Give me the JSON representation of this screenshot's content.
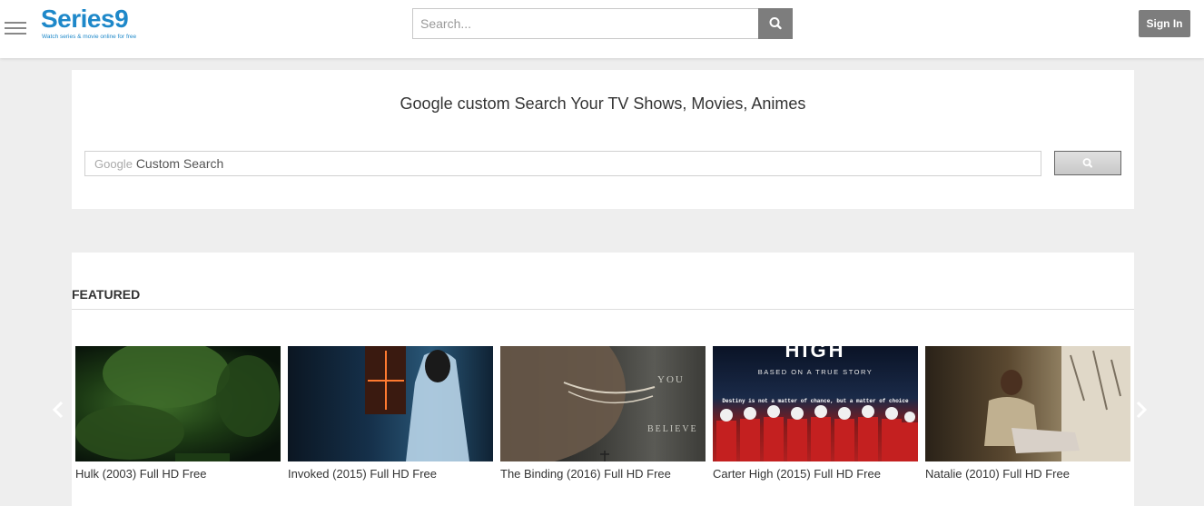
{
  "header": {
    "logo_text": "Series9",
    "logo_tagline": "Watch series & movie online for free",
    "search_placeholder": "Search...",
    "signin_label": "Sign In"
  },
  "google_panel": {
    "title": "Google custom Search Your TV Shows, Movies, Animes",
    "brand_word": "Google",
    "field_text": "Custom Search"
  },
  "featured": {
    "heading": "FEATURED",
    "items": [
      {
        "title": "Hulk (2003) Full HD Free"
      },
      {
        "title": "Invoked (2015) Full HD Free"
      },
      {
        "title": "The Binding (2016) Full HD Free"
      },
      {
        "title": "Carter High (2015) Full HD Free"
      },
      {
        "title": "Natalie (2010) Full HD Free"
      }
    ]
  },
  "poster_text": {
    "binding_top": "YOU",
    "binding_bottom": "BELIEVE",
    "carter_big": "HIGH",
    "carter_sub": "BASED ON A TRUE STORY",
    "carter_tag": "Destiny is not a matter of chance, but a matter of choice"
  },
  "colors": {
    "brand": "#1e88c9",
    "button_gray": "#7d7d7d",
    "page_bg": "#eeeeee"
  }
}
